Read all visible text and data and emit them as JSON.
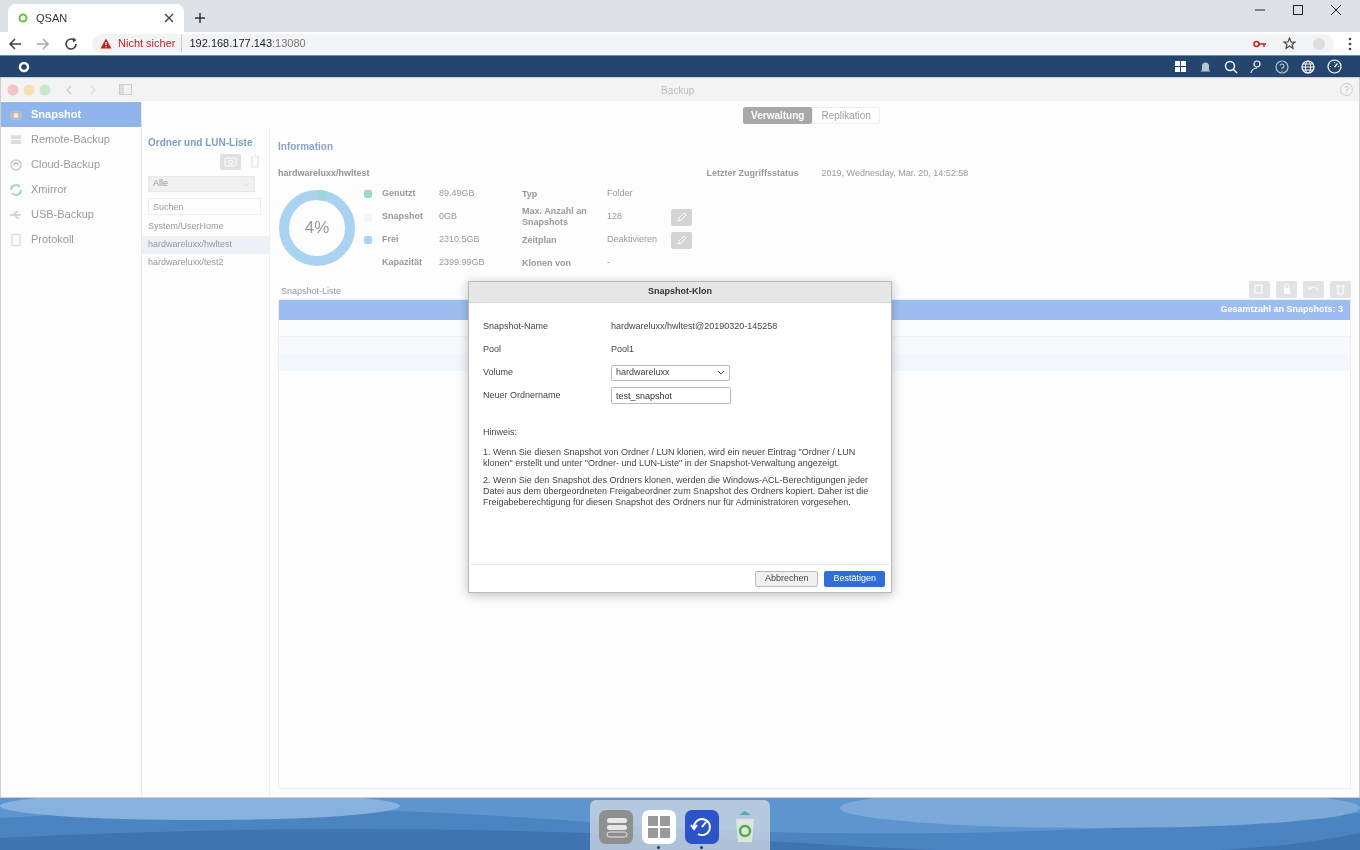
{
  "browser": {
    "tab_title": "QSAN",
    "url_warning": "Nicht sicher",
    "url_host": "192.168.177.143",
    "url_port": ":13080"
  },
  "app_window": {
    "title": "Backup",
    "tabs": [
      {
        "label": "Verwaltung",
        "selected": true
      },
      {
        "label": "Replikation",
        "selected": false
      }
    ]
  },
  "sidebar": {
    "items": [
      {
        "label": "Snapshot",
        "selected": true
      },
      {
        "label": "Remote-Backup",
        "selected": false
      },
      {
        "label": "Cloud-Backup",
        "selected": false
      },
      {
        "label": "Xmirror",
        "selected": false
      },
      {
        "label": "USB-Backup",
        "selected": false
      },
      {
        "label": "Protokoll",
        "selected": false
      }
    ]
  },
  "folder_panel": {
    "title": "Ordner und LUN-Liste",
    "filter": "Alle",
    "search": {
      "placeholder": "Suchen"
    },
    "items": [
      {
        "label": "System/UserHome",
        "selected": false
      },
      {
        "label": "hardwareluxx/hwltest",
        "selected": true
      },
      {
        "label": "hardwareluxx/test2",
        "selected": false
      }
    ]
  },
  "information": {
    "title": "Information",
    "volume": "hardwareluxx/hwltest",
    "last_access_label": "Letzter Zugriffsstatus",
    "last_access_value": "2019, Wednesday, Mar. 20, 14:52:58",
    "usage": {
      "text": "4%",
      "level": 0.04
    },
    "legend": [
      {
        "label": "Genutzt",
        "value": "89.49GB",
        "color": "#9ad8d4"
      },
      {
        "label": "Snapshot",
        "value": "0GB",
        "color": "#f3f3f3"
      },
      {
        "label": "Frei",
        "value": "2310.5GB",
        "color": "#a9d3f0"
      },
      {
        "label": "Kapazität",
        "value": "2399.99GB"
      }
    ],
    "properties": [
      {
        "label": "Typ",
        "value": "Folder",
        "editable": false
      },
      {
        "label": "Max. Anzahl an Snapshots",
        "value": "128",
        "editable": true
      },
      {
        "label": "Zeitplan",
        "value": "Deaktivieren",
        "editable": true
      },
      {
        "label": "Klonen von",
        "value": "-",
        "editable": false
      }
    ]
  },
  "snapshot_list": {
    "title": "Snapshot-Liste",
    "total": "Gesamtzahl an Snapshots: 3"
  },
  "dialog": {
    "title": "Snapshot-Klon",
    "fields": [
      {
        "kind": "text",
        "label": "Snapshot-Name",
        "value": "hardwareluxx/hwltest@20190320-145258"
      },
      {
        "kind": "text",
        "label": "Pool",
        "value": "Pool1"
      },
      {
        "kind": "select",
        "label": "Volume",
        "value": "hardwareluxx"
      },
      {
        "kind": "input",
        "label": "Neuer Ordnername",
        "value": "test_snapshot"
      }
    ],
    "note_title": "Hinweis:",
    "notes": [
      "1. Wenn Sie diesen Snapshot von Ordner / LUN klonen, wird ein neuer Eintrag \"Ordner / LUN klonen\" erstellt und unter \"Ordner- und LUN-Liste\" in der Snapshot-Verwaltung angezeigt.",
      "2. Wenn Sie den Snapshot des Ordners klonen, werden die Windows-ACL-Berechtigungen jeder Datei aus dem übergeordneten Freigabeordner zum Snapshot des Ordners kopiert. Daher ist die Freigabeberechtigung für diesen Snapshot des Ordners nur für Administratoren vorgesehen."
    ],
    "buttons": [
      {
        "label": "Abbrechen",
        "primary": false
      },
      {
        "label": "Bestätigen",
        "primary": true
      }
    ]
  },
  "dock": [
    {
      "kind": "settings",
      "running": false
    },
    {
      "kind": "apps",
      "running": true
    },
    {
      "kind": "backup",
      "running": true
    },
    {
      "kind": "trash",
      "running": false
    }
  ]
}
